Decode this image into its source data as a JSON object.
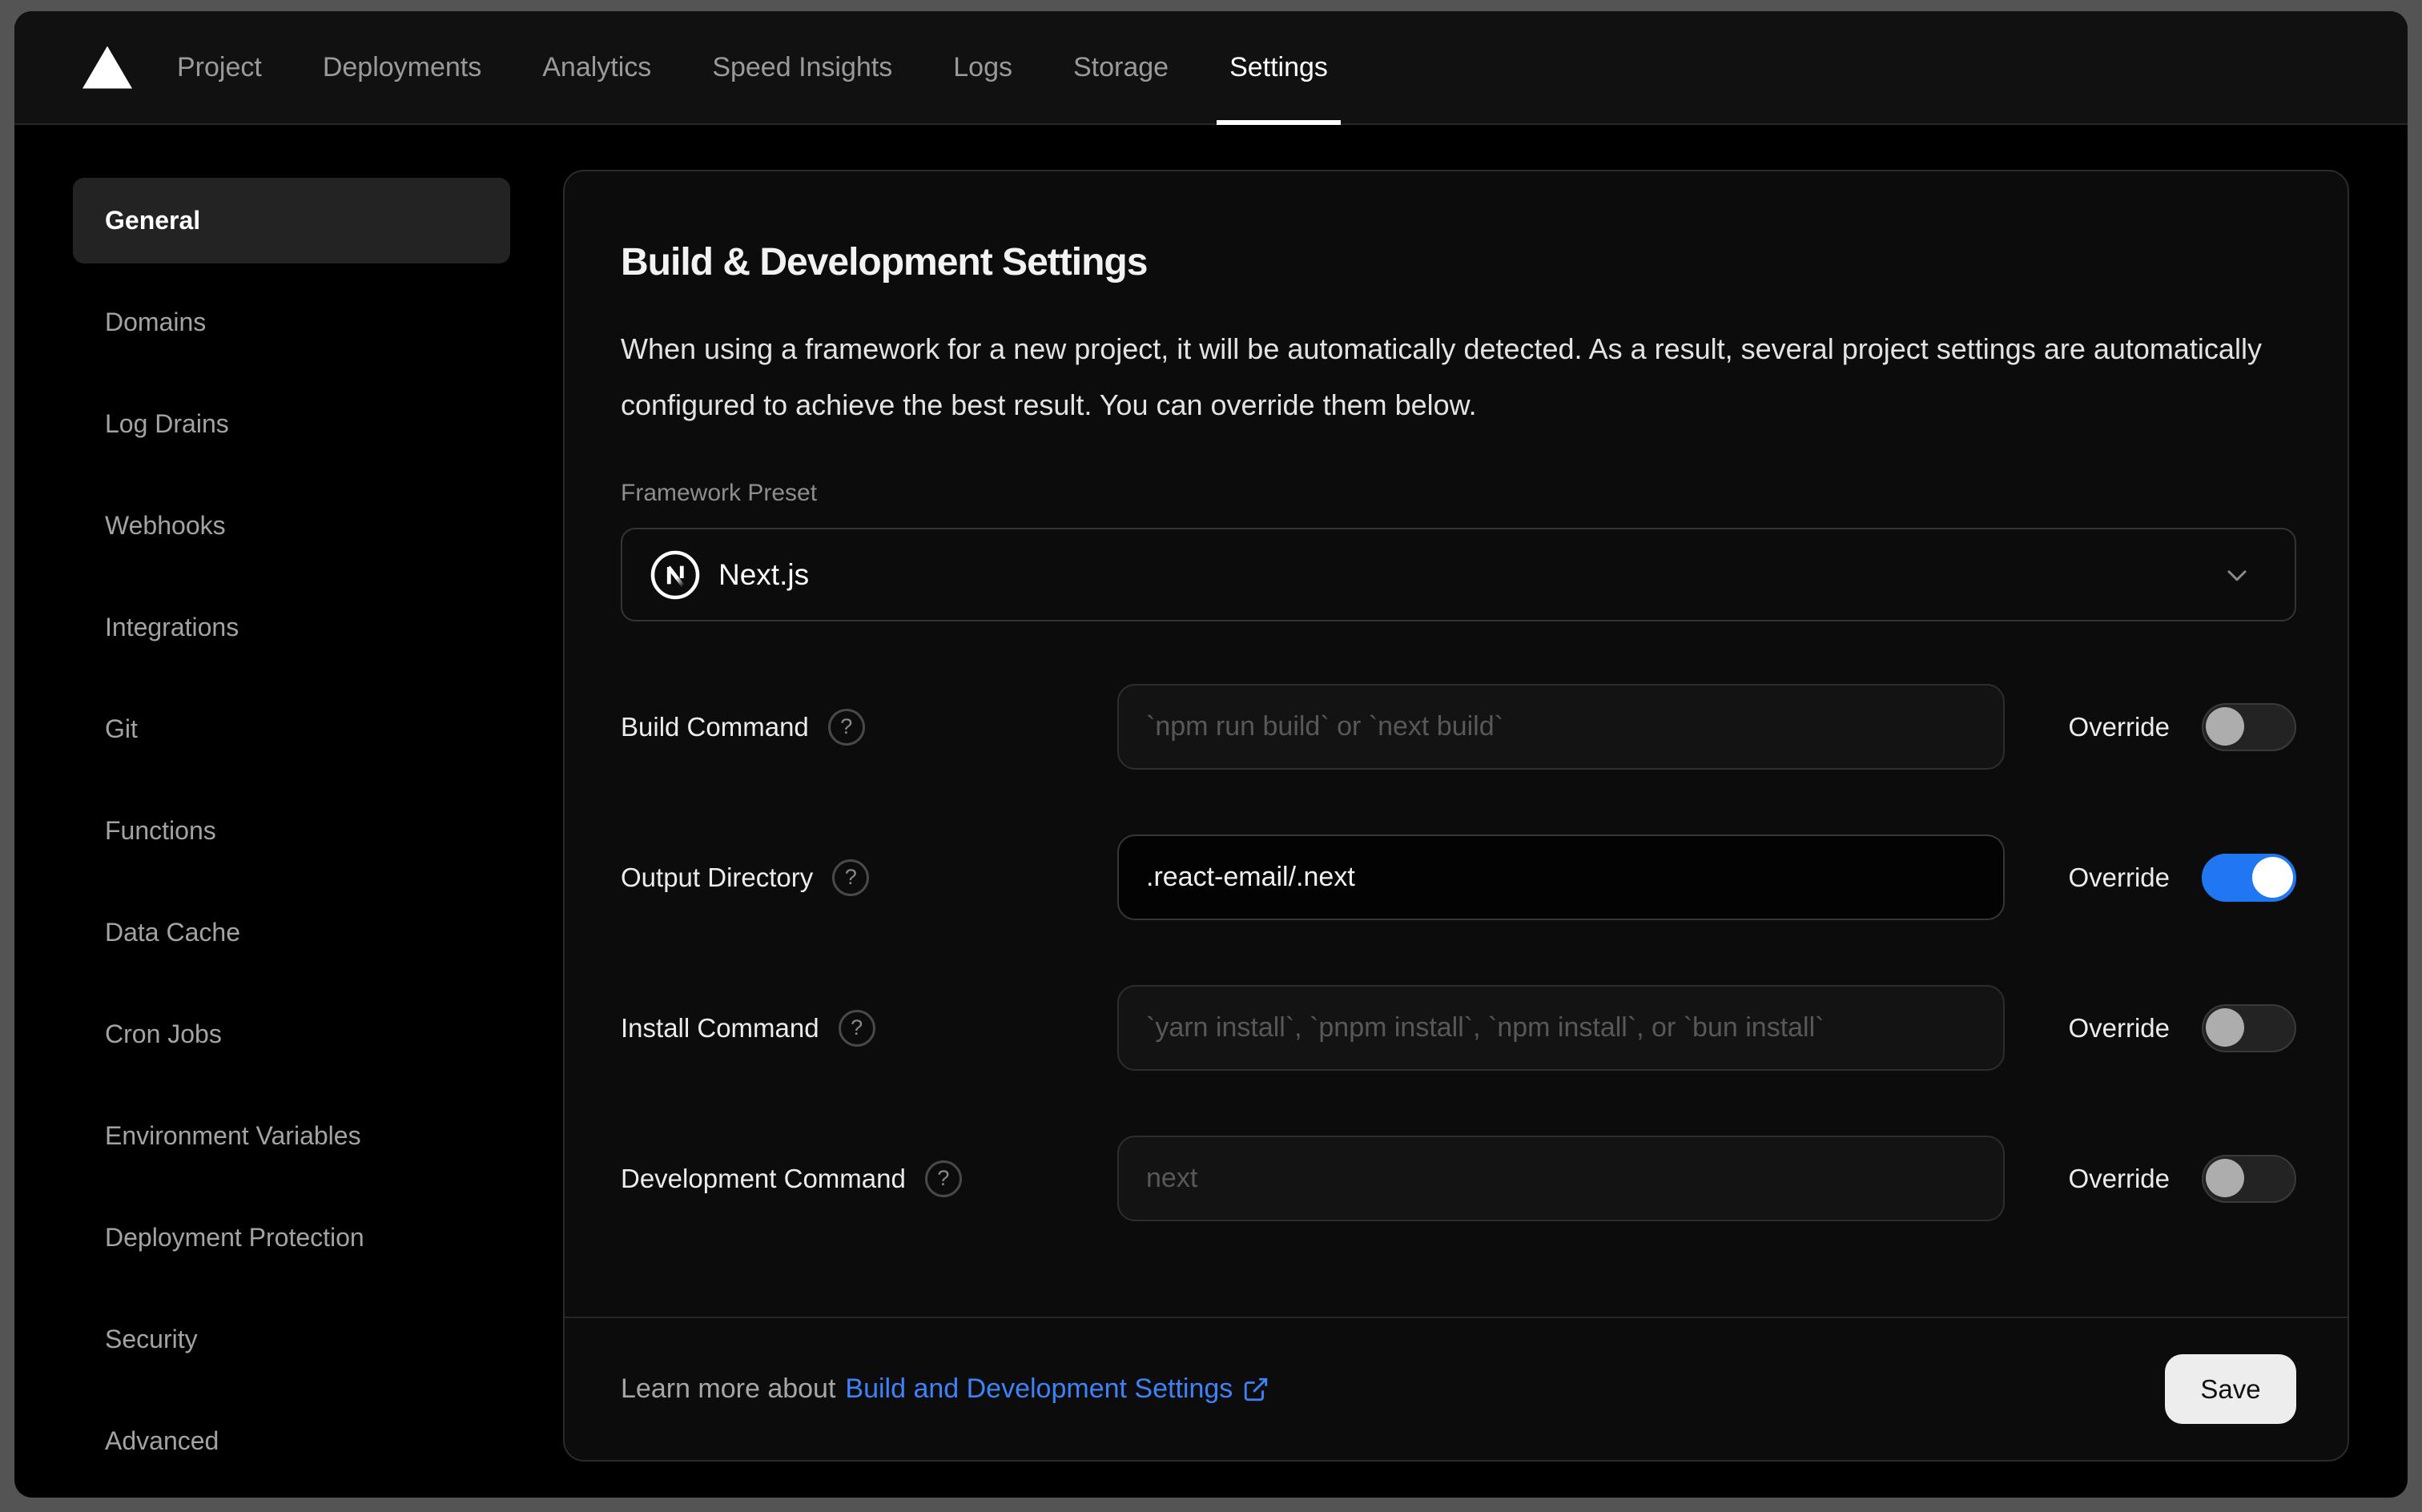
{
  "nav": {
    "tabs": [
      {
        "label": "Project",
        "active": false
      },
      {
        "label": "Deployments",
        "active": false
      },
      {
        "label": "Analytics",
        "active": false
      },
      {
        "label": "Speed Insights",
        "active": false
      },
      {
        "label": "Logs",
        "active": false
      },
      {
        "label": "Storage",
        "active": false
      },
      {
        "label": "Settings",
        "active": true
      }
    ]
  },
  "sidebar": {
    "items": [
      {
        "label": "General",
        "active": true
      },
      {
        "label": "Domains",
        "active": false
      },
      {
        "label": "Log Drains",
        "active": false
      },
      {
        "label": "Webhooks",
        "active": false
      },
      {
        "label": "Integrations",
        "active": false
      },
      {
        "label": "Git",
        "active": false
      },
      {
        "label": "Functions",
        "active": false
      },
      {
        "label": "Data Cache",
        "active": false
      },
      {
        "label": "Cron Jobs",
        "active": false
      },
      {
        "label": "Environment Variables",
        "active": false
      },
      {
        "label": "Deployment Protection",
        "active": false
      },
      {
        "label": "Security",
        "active": false
      },
      {
        "label": "Advanced",
        "active": false
      }
    ]
  },
  "panel": {
    "title": "Build & Development Settings",
    "description": "When using a framework for a new project, it will be automatically detected. As a result, several project settings are automatically configured to achieve the best result. You can override them below.",
    "framework": {
      "label": "Framework Preset",
      "value": "Next.js",
      "icon": "nextjs-logo-icon"
    },
    "override_label": "Override",
    "rows": [
      {
        "label": "Build Command",
        "placeholder": "`npm run build` or `next build`",
        "value": "",
        "enabled": false,
        "override_on": false
      },
      {
        "label": "Output Directory",
        "placeholder": "",
        "value": ".react-email/.next",
        "enabled": true,
        "override_on": true
      },
      {
        "label": "Install Command",
        "placeholder": "`yarn install`, `pnpm install`, `npm install`, or `bun install`",
        "value": "",
        "enabled": false,
        "override_on": false
      },
      {
        "label": "Development Command",
        "placeholder": "next",
        "value": "",
        "enabled": false,
        "override_on": false
      }
    ],
    "footer": {
      "learn_more_prefix": "Learn more about",
      "link_text": "Build and Development Settings",
      "save_label": "Save"
    }
  },
  "colors": {
    "accent_toggle_on": "#2177f2",
    "link_blue": "#3e82f7",
    "window_background": "#000000",
    "card_background": "#0c0c0c",
    "desktop_background": "#545454"
  }
}
